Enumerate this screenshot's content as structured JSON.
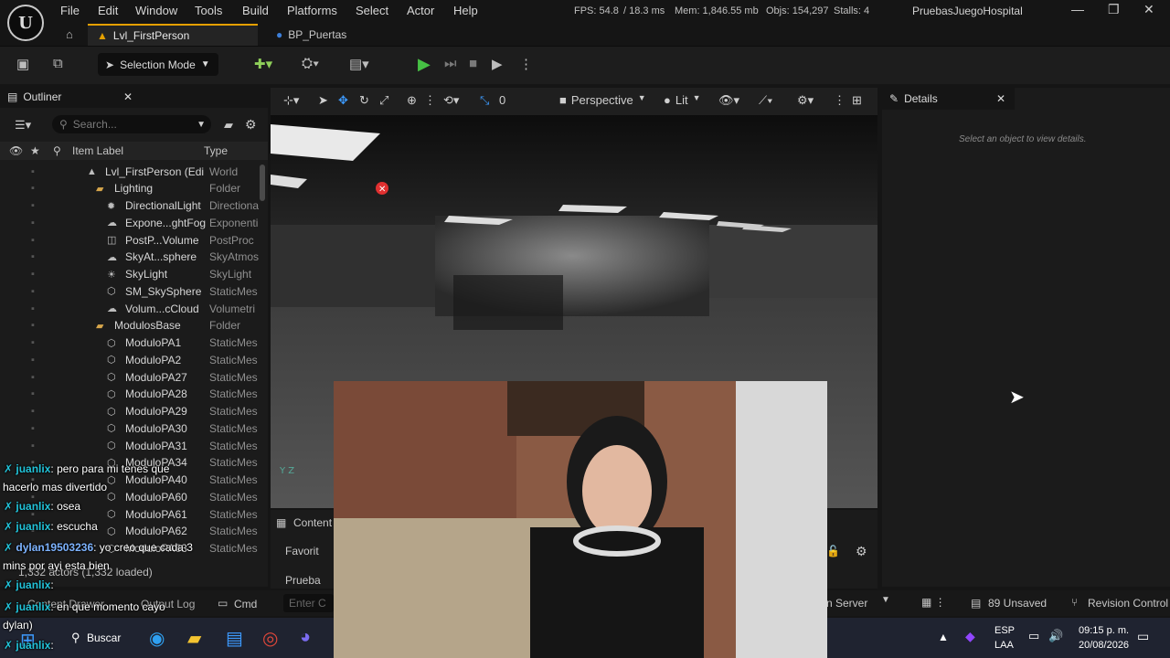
{
  "menu": [
    "File",
    "Edit",
    "Window",
    "Tools",
    "Build",
    "Platforms",
    "Select",
    "Actor",
    "Help"
  ],
  "stats": {
    "fps": "FPS: 54.8",
    "ms": "/ 18.3 ms",
    "mem": "Mem: 1,846.55 mb",
    "objs": "Objs: 154,297",
    "stalls": "Stalls: 4"
  },
  "project_name": "PruebasJuegoHospital",
  "tabs": [
    {
      "label": "Lvl_FirstPerson"
    },
    {
      "label": "BP_Puertas"
    }
  ],
  "toolbar": {
    "selection_mode": "Selection Mode"
  },
  "outliner": {
    "title": "Outliner",
    "search_placeholder": "Search...",
    "col_label": "Item Label",
    "col_type": "Type",
    "rows": [
      {
        "label": "Lvl_FirstPerson (Edi",
        "type": "World",
        "indent": 115,
        "icon": "▲"
      },
      {
        "label": "Lighting",
        "type": "Folder",
        "indent": 125,
        "icon": "▰"
      },
      {
        "label": "DirectionalLight",
        "type": "Directiona",
        "indent": 137,
        "icon": "✹"
      },
      {
        "label": "Expone...ghtFog",
        "type": "Exponenti",
        "indent": 137,
        "icon": "☁"
      },
      {
        "label": "PostP...Volume",
        "type": "PostProc",
        "indent": 137,
        "icon": "◫"
      },
      {
        "label": "SkyAt...sphere",
        "type": "SkyAtmos",
        "indent": 137,
        "icon": "☁"
      },
      {
        "label": "SkyLight",
        "type": "SkyLight",
        "indent": 137,
        "icon": "☀"
      },
      {
        "label": "SM_SkySphere",
        "type": "StaticMes",
        "indent": 137,
        "icon": "⬡"
      },
      {
        "label": "Volum...cCloud",
        "type": "Volumetri",
        "indent": 137,
        "icon": "☁"
      },
      {
        "label": "ModulosBase",
        "type": "Folder",
        "indent": 125,
        "icon": "▰"
      },
      {
        "label": "ModuloPA1",
        "type": "StaticMes",
        "indent": 137,
        "icon": "⬡"
      },
      {
        "label": "ModuloPA2",
        "type": "StaticMes",
        "indent": 137,
        "icon": "⬡"
      },
      {
        "label": "ModuloPA27",
        "type": "StaticMes",
        "indent": 137,
        "icon": "⬡"
      },
      {
        "label": "ModuloPA28",
        "type": "StaticMes",
        "indent": 137,
        "icon": "⬡"
      },
      {
        "label": "ModuloPA29",
        "type": "StaticMes",
        "indent": 137,
        "icon": "⬡"
      },
      {
        "label": "ModuloPA30",
        "type": "StaticMes",
        "indent": 137,
        "icon": "⬡"
      },
      {
        "label": "ModuloPA31",
        "type": "StaticMes",
        "indent": 137,
        "icon": "⬡"
      },
      {
        "label": "ModuloPA34",
        "type": "StaticMes",
        "indent": 137,
        "icon": "⬡"
      },
      {
        "label": "ModuloPA40",
        "type": "StaticMes",
        "indent": 137,
        "icon": "⬡"
      },
      {
        "label": "ModuloPA60",
        "type": "StaticMes",
        "indent": 137,
        "icon": "⬡"
      },
      {
        "label": "ModuloPA61",
        "type": "StaticMes",
        "indent": 137,
        "icon": "⬡"
      },
      {
        "label": "ModuloPA62",
        "type": "StaticMes",
        "indent": 137,
        "icon": "⬡"
      },
      {
        "label": "ModuloPA63",
        "type": "StaticMes",
        "indent": 137,
        "icon": "⬡"
      }
    ],
    "footer": "1,332 actors (1,332 loaded)"
  },
  "viewport": {
    "perspective": "Perspective",
    "lit": "Lit",
    "speed": "0"
  },
  "details": {
    "title": "Details",
    "empty": "Select an object to view details."
  },
  "content_browser": {
    "tab": "Content",
    "fav": "Favorit",
    "folder": "Prueba"
  },
  "status": {
    "content_drawer": "Content Drawer",
    "output_log": "Output Log",
    "cmd": "Cmd",
    "cmd_placeholder": "Enter C",
    "server": "n Server",
    "unsaved": "89 Unsaved",
    "revision": "Revision Control"
  },
  "chat": [
    {
      "name": "juanlix",
      "text": ": pero para mi tenes que"
    },
    {
      "name": "",
      "text": "hacerlo mas divertido"
    },
    {
      "name": "juanlix",
      "text": ": osea"
    },
    {
      "name": "juanlix",
      "text": ": escucha"
    },
    {
      "name": "dylan19503236",
      "text": ": yo creo que cada 3"
    },
    {
      "name": "",
      "text": "mins por ayi esta bien"
    },
    {
      "name": "juanlix",
      "text": ":"
    },
    {
      "name": "juanlix",
      "text": ": en que momento cayo"
    },
    {
      "name": "",
      "text": "dylan)"
    },
    {
      "name": "juanlix",
      "text": ":"
    }
  ],
  "taskbar": {
    "search": "Buscar",
    "lang1": "ESP",
    "lang2": "LAA",
    "time": "09:15 p. m.",
    "date": "20/08/2026"
  },
  "colors": {
    "accent": "#e5a000",
    "play": "#46c044",
    "bg": "#151515"
  }
}
